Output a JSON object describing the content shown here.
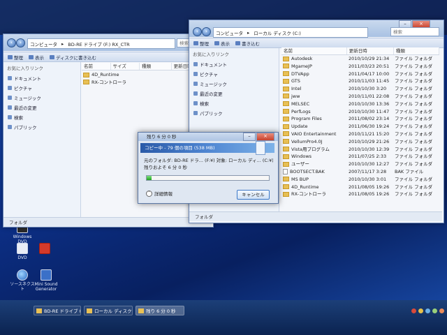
{
  "desktop_icons": [
    {
      "label": "Windows DVD",
      "icon": "dvd-icon"
    },
    {
      "label": "DVD",
      "icon": "dvd-icon"
    },
    {
      "label": "",
      "icon": "app-icon"
    },
    {
      "label": "ソースネクスト",
      "icon": "globe-icon"
    },
    {
      "label": "Mini Sound Generator",
      "icon": "sound-icon"
    }
  ],
  "left_window": {
    "address": [
      "コンピュータ",
      "BD-RE ドライブ (F:) RX_CTR"
    ],
    "search": "検索",
    "toolbar": [
      "整理",
      "表示",
      "ディスクに書き込む"
    ],
    "nav_header": "お気に入りリンク",
    "nav_items": [
      "ドキュメント",
      "ピクチャ",
      "ミュージック",
      "最近の変更",
      "検索",
      "パブリック"
    ],
    "columns": [
      "名前",
      "サイズ",
      "種類",
      "更新日時"
    ],
    "files": [
      {
        "name": "4D_Runtime"
      },
      {
        "name": "RX-コントローラ"
      }
    ],
    "status": "フォルダ"
  },
  "right_window": {
    "address": [
      "コンピュータ",
      "ローカル ディスク (C:)"
    ],
    "search": "検索",
    "toolbar": [
      "整理",
      "表示",
      "書き込む"
    ],
    "nav_header": "お気に入りリンク",
    "nav_items": [
      "ドキュメント",
      "ピクチャ",
      "ミュージック",
      "最近の変更",
      "検索",
      "パブリック"
    ],
    "columns": [
      "名前",
      "更新日時",
      "種類"
    ],
    "files": [
      {
        "name": "Autodesk",
        "date": "2010/10/29 21:34",
        "type": "ファイル フォルダ",
        "kind": "folder"
      },
      {
        "name": "MgameJP",
        "date": "2011/03/23 20:51",
        "type": "ファイル フォルダ",
        "kind": "folder"
      },
      {
        "name": "DTVApp",
        "date": "2011/04/17 10:00",
        "type": "ファイル フォルダ",
        "kind": "folder"
      },
      {
        "name": "GTS",
        "date": "2010/11/03 11:45",
        "type": "ファイル フォルダ",
        "kind": "folder"
      },
      {
        "name": "Intel",
        "date": "2010/10/30 3:20",
        "type": "ファイル フォルダ",
        "kind": "folder"
      },
      {
        "name": "jww",
        "date": "2010/11/01 22:08",
        "type": "ファイル フォルダ",
        "kind": "folder"
      },
      {
        "name": "MELSEC",
        "date": "2010/10/30 13:36",
        "type": "ファイル フォルダ",
        "kind": "folder"
      },
      {
        "name": "PerfLogs",
        "date": "2010/10/30 11:47",
        "type": "ファイル フォルダ",
        "kind": "folder"
      },
      {
        "name": "Program Files",
        "date": "2011/08/02 23:14",
        "type": "ファイル フォルダ",
        "kind": "folder"
      },
      {
        "name": "Update",
        "date": "2011/06/30 19:24",
        "type": "ファイル フォルダ",
        "kind": "folder"
      },
      {
        "name": "VAIO Entertainment",
        "date": "2010/11/21 15:20",
        "type": "ファイル フォルダ",
        "kind": "folder"
      },
      {
        "name": "VellumPro4.0J",
        "date": "2010/10/29 21:26",
        "type": "ファイル フォルダ",
        "kind": "folder"
      },
      {
        "name": "Vista用プログラム",
        "date": "2010/10/30 12:39",
        "type": "ファイル フォルダ",
        "kind": "folder"
      },
      {
        "name": "Windows",
        "date": "2011/07/25 2:33",
        "type": "ファイル フォルダ",
        "kind": "folder"
      },
      {
        "name": "ユーザー",
        "date": "2010/10/30 12:27",
        "type": "ファイル フォルダ",
        "kind": "folder"
      },
      {
        "name": "BOOTSECT.BAK",
        "date": "2007/11/17 3:28",
        "type": "BAK ファイル",
        "kind": "file"
      },
      {
        "name": "MS BUP",
        "date": "2010/10/30 3:01",
        "type": "ファイル フォルダ",
        "kind": "folder"
      },
      {
        "name": "4D_Runtime",
        "date": "2011/08/05 19:26",
        "type": "ファイル フォルダ",
        "kind": "folder"
      },
      {
        "name": "RX-コントローラ",
        "date": "2011/08/05 19:26",
        "type": "ファイル フォルダ",
        "kind": "folder"
      }
    ],
    "status": "フォルダ"
  },
  "dialog": {
    "title": "残り 6 分 0 秒",
    "banner": "コピー中 - 79 個の項目 (538 MB)",
    "line1": "元のフォルダ: BD-RE ドラ...   (F:¥)  対象: ローカル ディ...  (C:¥)",
    "line2": "残りおよそ 6 分 0 秒",
    "progress_percent": 4,
    "details_label": "詳細情報",
    "cancel_label": "キャンセル"
  },
  "taskbar": {
    "buttons": [
      "BD-RE ドライブ (...",
      "ローカル ディスク...",
      "残り 6 分 0 秒"
    ],
    "active_index": 2
  }
}
